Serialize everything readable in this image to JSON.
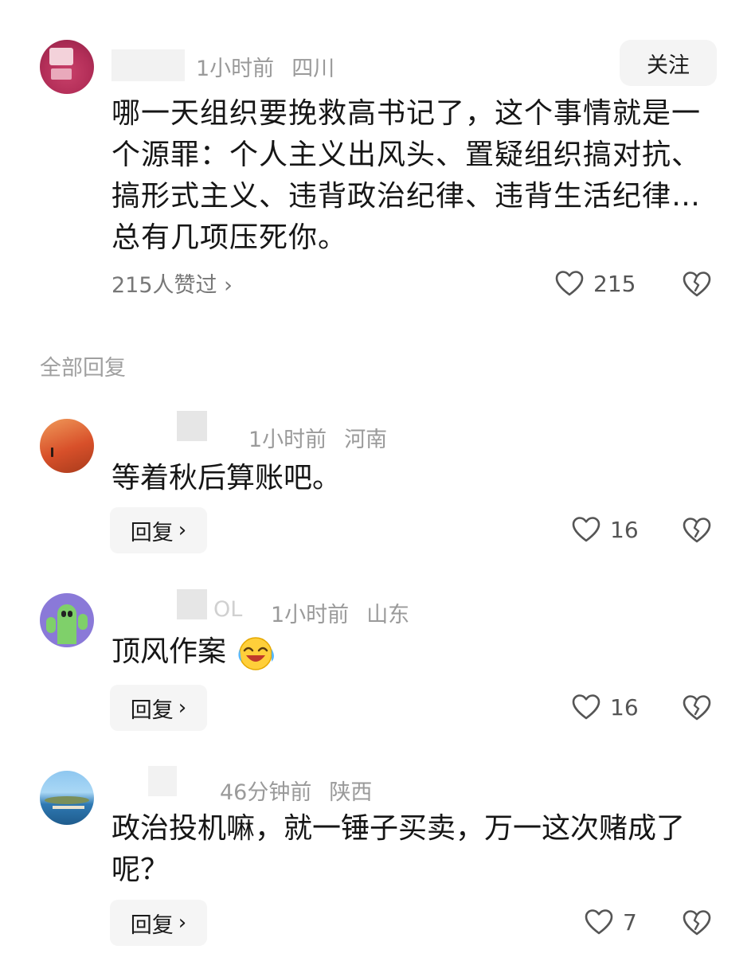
{
  "main_comment": {
    "time": "1小时前",
    "location": "四川",
    "follow_label": "关注",
    "text": "哪一天组织要挽救高书记了，这个事情就是一个源罪：个人主义出风头、置疑组织搞对抗、搞形式主义、违背政治纪律、违背生活纪律…总有几项压死你。",
    "likes_summary": "215人赞过 ›",
    "like_count": "215"
  },
  "replies_section": {
    "title": "全部回复"
  },
  "replies": [
    {
      "time": "1小时前",
      "location": "河南",
      "text": "等着秋后算账吧。",
      "reply_label": "回复",
      "like_count": "16"
    },
    {
      "name_fragment": "OL",
      "time": "1小时前",
      "location": "山东",
      "text": "顶风作案",
      "emoji": "laughing-crying-face",
      "reply_label": "回复",
      "like_count": "16"
    },
    {
      "time": "46分钟前",
      "location": "陕西",
      "text": "政治投机嘛，就一锤子买卖，万一这次赌成了呢？",
      "reply_label": "回复",
      "like_count": "7"
    }
  ],
  "icons": {
    "like": "heart-outline-icon",
    "dislike": "broken-heart-icon",
    "chevron": "chevron-right-icon"
  },
  "colors": {
    "meta_text": "#9a9a9a",
    "button_bg": "#f4f4f4"
  }
}
